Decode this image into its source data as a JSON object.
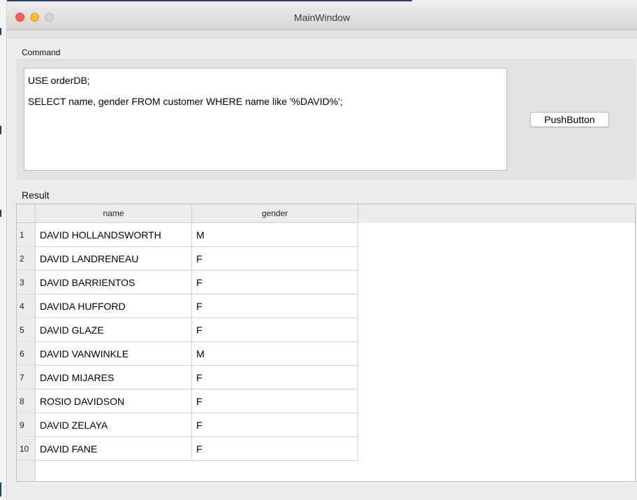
{
  "window": {
    "title": "MainWindow"
  },
  "command": {
    "label": "Command",
    "lines": [
      "USE orderDB;",
      "",
      "SELECT name, gender FROM customer WHERE name like '%DAVID%';"
    ]
  },
  "push_button": {
    "label": "PushButton"
  },
  "result": {
    "label": "Result",
    "columns": [
      "name",
      "gender"
    ],
    "rows": [
      {
        "num": "1",
        "name": "DAVID HOLLANDSWORTH",
        "gender": "M"
      },
      {
        "num": "2",
        "name": "DAVID LANDRENEAU",
        "gender": "F"
      },
      {
        "num": "3",
        "name": "DAVID BARRIENTOS",
        "gender": "F"
      },
      {
        "num": "4",
        "name": "DAVIDA HUFFORD",
        "gender": "F"
      },
      {
        "num": "5",
        "name": "DAVID GLAZE",
        "gender": "F"
      },
      {
        "num": "6",
        "name": "DAVID VANWINKLE",
        "gender": "M"
      },
      {
        "num": "7",
        "name": "DAVID MIJARES",
        "gender": "F"
      },
      {
        "num": "8",
        "name": "ROSIO DAVIDSON",
        "gender": "F"
      },
      {
        "num": "9",
        "name": "DAVID ZELAYA",
        "gender": "F"
      },
      {
        "num": "10",
        "name": "DAVID FANE",
        "gender": "F"
      }
    ]
  },
  "colors": {
    "close": "#fc5f57",
    "minimize": "#fdbb2d",
    "maximize": "#d3d3d3"
  }
}
